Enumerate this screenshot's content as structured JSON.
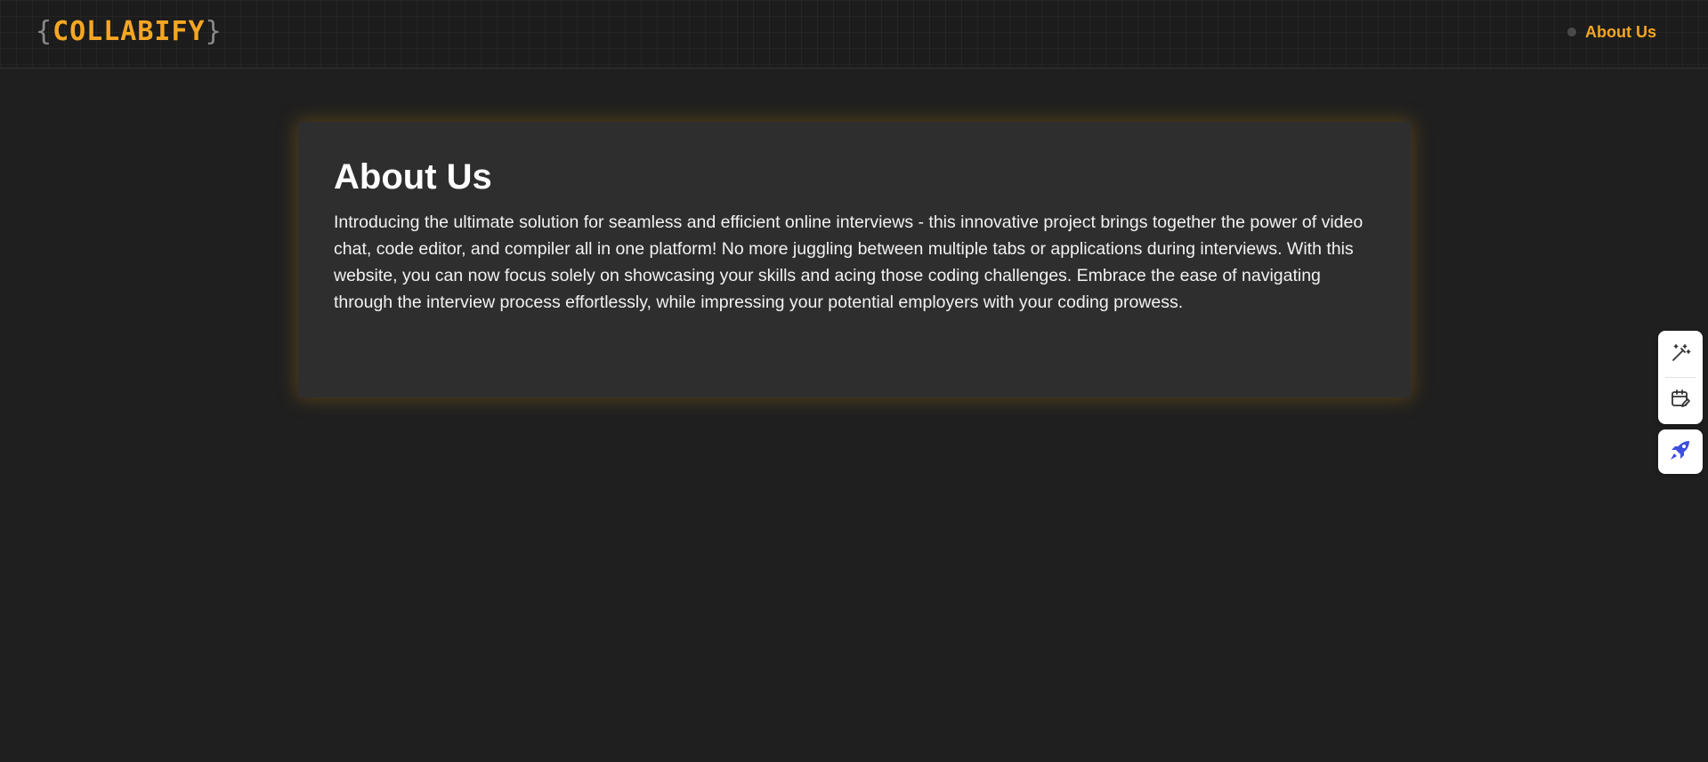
{
  "navbar": {
    "logo": {
      "open_brace": "{",
      "name": "COLLABIFY",
      "close_brace": "}"
    },
    "links": [
      {
        "label": "About Us",
        "icon": "dot-icon"
      }
    ]
  },
  "main": {
    "title": "About Us",
    "body": "Introducing the ultimate solution for seamless and efficient online interviews - this innovative project brings together the power of video chat, code editor, and compiler all in one platform! No more juggling between multiple tabs or applications during interviews. With this website, you can now focus solely on showcasing your skills and acing those coding challenges. Embrace the ease of navigating through the interview process effortlessly, while impressing your potential employers with your coding prowess."
  },
  "side_tools": {
    "items": [
      "magic-wand-icon",
      "calendar-edit-icon"
    ],
    "launcher": "rocket-icon"
  },
  "colors": {
    "background": "#1f1f1f",
    "navbar": "#1c1c1c",
    "accent": "#f5a623",
    "card": "#2e2e2e",
    "card_glow": "#be8214",
    "brace": "#8a8a8a",
    "launcher_icon": "#3d4fe0"
  }
}
